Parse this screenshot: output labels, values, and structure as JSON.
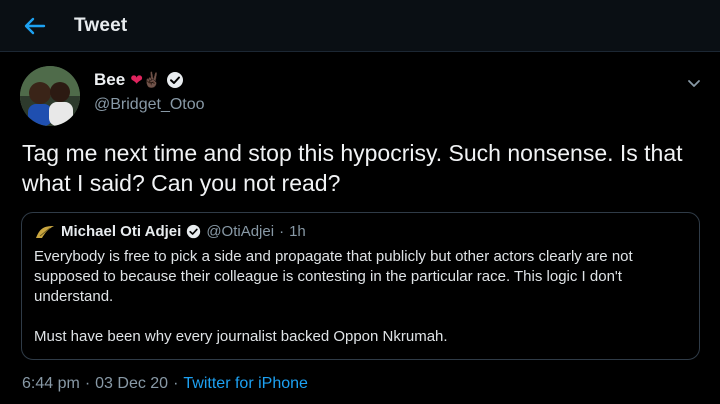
{
  "header": {
    "title": "Tweet",
    "back_icon": "arrow-left-icon"
  },
  "tweet": {
    "author": {
      "display_name": "Bee",
      "emoji": "❤✌🏿",
      "handle": "@Bridget_Otoo",
      "verified": true
    },
    "text": "Tag me next time and stop this hypocrisy. Such nonsense. Is that what I said? Can you not read?",
    "quoted": {
      "author_name": "Michael Oti Adjei",
      "handle": "@OtiAdjei",
      "separator": "·",
      "time": "1h",
      "paragraph_1": "Everybody is free to pick a side and propagate that publicly but other actors clearly are not supposed to because their colleague is contesting in the particular race. This logic I don't understand.",
      "paragraph_2": "Must have been why every journalist backed Oppon Nkrumah."
    },
    "meta": {
      "time": "6:44 pm",
      "separator": "·",
      "date": "03 Dec 20",
      "source": "Twitter for iPhone"
    }
  },
  "colors": {
    "background": "#000000",
    "accent": "#1da1f2",
    "secondary_text": "#8899a6",
    "heart": "#e0245e"
  }
}
